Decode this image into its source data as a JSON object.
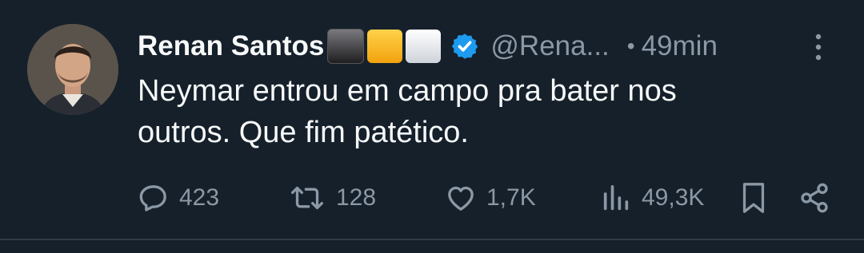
{
  "tweet": {
    "author_name": "Renan Santos",
    "name_emojis": [
      "black-square",
      "yellow-square",
      "white-square"
    ],
    "verified": true,
    "handle": "@Rena...",
    "separator": "•",
    "time": "49min",
    "text_lines": [
      "Neymar entrou em campo pra bater nos",
      "outros. Que fim patético."
    ],
    "actions": {
      "replies": "423",
      "retweets": "128",
      "likes": "1,7K",
      "views": "49,3K"
    }
  },
  "colors": {
    "background": "#15202b",
    "primary_text": "#f7f9f9",
    "secondary_text": "#8b98a5",
    "verified_badge": "#1d9bf0",
    "divider": "#2f3b47"
  },
  "icons": [
    "more-icon",
    "reply-icon",
    "retweet-icon",
    "like-icon",
    "views-icon",
    "bookmark-icon",
    "share-icon",
    "verified-badge-icon"
  ]
}
